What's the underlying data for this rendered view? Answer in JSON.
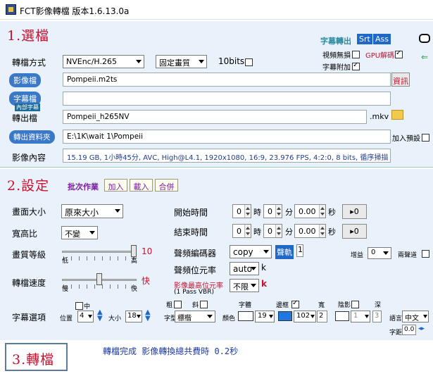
{
  "window": {
    "title": "FCT影像轉檔 版本1.6.13.0a"
  },
  "section1": {
    "title": "1.選檔",
    "subtitle_output": "字幕轉出",
    "srt": "Srt",
    "ass": "Ass",
    "convert_mode_label": "轉檔方式",
    "codec": "NVEnc/H.265",
    "quality_mode": "固定畫質",
    "tenbit_label": "10bits",
    "lossless_video_label": "視頻無損",
    "gpu_decode_label": "GPU解碼",
    "subtitle_attach_label": "字幕附加",
    "video_file_label": "影像檔",
    "video_file_value": "Pompeii.m2ts",
    "info_button": "資訊",
    "subtitle_file_label": "字幕檔",
    "internal_sub_badge": "內部字幕",
    "subtitle_file_value": "",
    "output_file_label": "轉出檔",
    "output_file_value": "Pompeii_h265NV",
    "output_ext": ".mkv",
    "output_folder_label": "轉出資料夾",
    "output_folder_value": "E:\\1K\\wait 1\\Pompeii",
    "add_preset_label": "加入預設",
    "video_content_label": "影像內容",
    "video_content_value": "15.19 GB, 1小時45分, AVC, High@L4.1, 1920x1080, 16:9, 23.976 FPS, 4:2:0, 8 bits, 循序掃描"
  },
  "section2": {
    "title": "2.設定",
    "batch_label": "批次作業",
    "add_button": "加入",
    "load_button": "載入",
    "merge_button": "合併",
    "resolution_label": "畫面大小",
    "resolution_value": "原來大小",
    "aspect_label": "寬高比",
    "aspect_value": "不變",
    "quality_label": "畫質等級",
    "quality_value": "10",
    "quality_low": "低",
    "quality_high": "高",
    "speed_label": "轉檔速度",
    "speed_value": "快",
    "speed_slow": "慢",
    "speed_fast": "快",
    "start_time_label": "開始時間",
    "end_time_label": "結束時間",
    "hour_unit": "時",
    "min_unit": "分",
    "sec_unit": "秒",
    "start_h": "0",
    "start_m": "0",
    "start_s": "0.00",
    "end_h": "0",
    "end_m": "0",
    "end_s": "0.00",
    "set_button": "▸0",
    "audio_encoder_label": "聲頻編碼器",
    "audio_encoder_value": "copy",
    "audio_track_label": "聲軌",
    "audio_track_value": "1",
    "gain_label": "增益",
    "gain_value": "0",
    "two_channel_label": "兩聲道",
    "audio_bitrate_label": "聲頻位元率",
    "audio_bitrate_value": "auto",
    "audio_bitrate_unit": "k",
    "max_bitrate_label": "影像最高位元率",
    "max_bitrate_note": "(1 Pass VBR)",
    "max_bitrate_value": "不限",
    "max_bitrate_unit": "k",
    "subtitle_options_label": "字幕選項",
    "center_label": "中",
    "position_label": "位置",
    "position_value": "4",
    "size_label": "大小",
    "size_value": "18",
    "font_label": "字型",
    "font_value": "標楷",
    "bold_label": "粗",
    "italic_label": "斜",
    "color_label": "顏色",
    "font_size_label": "字體",
    "font_size_value": "19",
    "outline_label": "邊框",
    "outline_value": "102",
    "width_label": "寬",
    "width_value": "2",
    "shadow_label": "陰影",
    "shadow_value": "1",
    "depth_label": "深",
    "depth_value": "3",
    "language_label": "語言",
    "language_value": "中文",
    "spacing_label": "字距",
    "spacing_value": "0.0"
  },
  "section3": {
    "title": "3.轉檔",
    "status": "轉檔完成 影像轉換總共費時 0.2秒"
  },
  "colors": {
    "accent_red": "#c8102e",
    "panel": "#e9f1fa",
    "highlight_blue": "#3a78c8"
  }
}
